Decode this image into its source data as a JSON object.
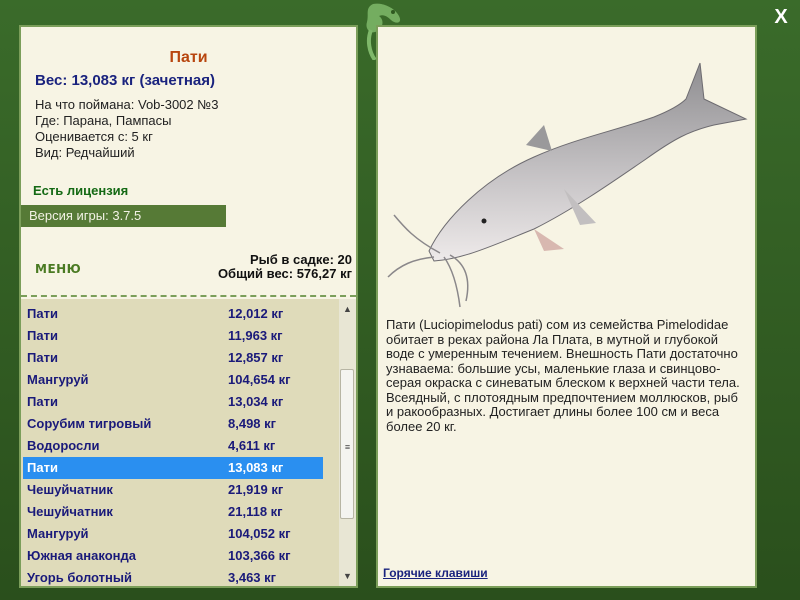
{
  "window": {
    "close_label": "X"
  },
  "fish": {
    "title": "Пати",
    "weight": "Вес: 13,083 кг (зачетная)",
    "caught_on": "На что поймана: Vob-3002 №3",
    "where": "Где: Парана, Пампасы",
    "rated_from": "Оценивается с: 5 кг",
    "kind": "Вид: Редчайший"
  },
  "license_text": "Есть лицензия",
  "version_text": "Версия игры: 3.7.5",
  "menu_label": "МЕНЮ",
  "stats": {
    "fish_count": "Рыб в садке: 20",
    "total_weight": "Общий вес: 576,27 кг"
  },
  "catch_list": [
    {
      "name": "Пати",
      "weight": "12,012 кг"
    },
    {
      "name": "Пати",
      "weight": "11,963 кг"
    },
    {
      "name": "Пати",
      "weight": "12,857 кг"
    },
    {
      "name": "Мангуруй",
      "weight": "104,654 кг"
    },
    {
      "name": "Пати",
      "weight": "13,034 кг"
    },
    {
      "name": "Сорубим тигровый",
      "weight": "8,498 кг"
    },
    {
      "name": "Водоросли",
      "weight": "4,611 кг"
    },
    {
      "name": "Пати",
      "weight": "13,083 кг"
    },
    {
      "name": "Чешуйчатник",
      "weight": "21,919 кг"
    },
    {
      "name": "Чешуйчатник",
      "weight": "21,118 кг"
    },
    {
      "name": "Мангуруй",
      "weight": "104,052 кг"
    },
    {
      "name": "Южная анаконда",
      "weight": "103,366 кг"
    },
    {
      "name": "Угорь болотный",
      "weight": "3,463 кг"
    }
  ],
  "selected_index": 7,
  "description": "Пати (Luciopimelodus pati) сом из семейства Pimelodidae обитает в реках района Ла Плата, в мутной и глубокой воде с умеренным течением. Внешность Пати достаточно узнаваема: большие усы, маленькие глаза и свинцово-серая окраска с синеватым блеском к верхней части тела. Всеядный, с плотоядным предпочтением моллюсков, рыб и ракообразных. Достигает длины более 100 см и веса более 20 кг.",
  "hotkeys_label": "Горячие клавиши",
  "scrollbar": {
    "up_icon": "▲",
    "down_icon": "▼",
    "grip_icon": "≡"
  },
  "colors": {
    "frame": "#2f5a20",
    "panel": "#f7f4e4",
    "selection": "#2a8ff0",
    "title": "#b8460f",
    "weight": "#1a237e"
  }
}
